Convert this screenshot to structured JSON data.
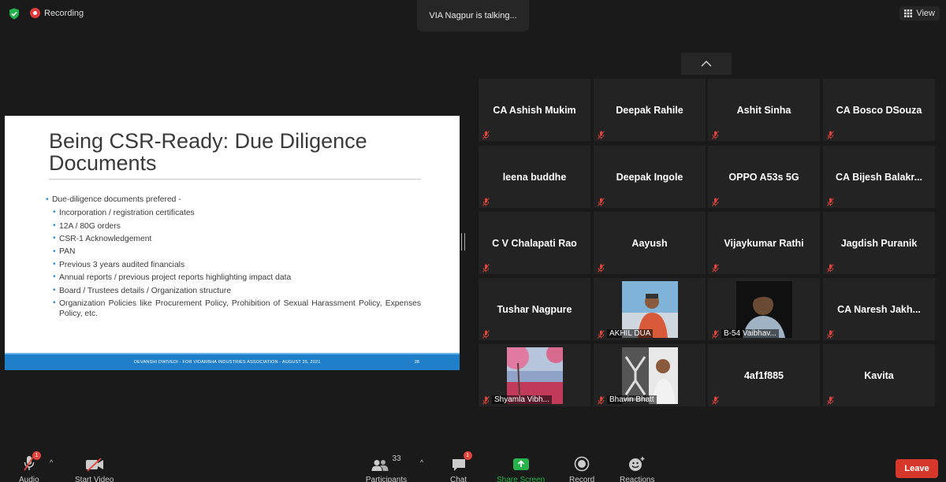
{
  "top": {
    "recording_label": "Recording",
    "talking_label": "VIA Nagpur is talking...",
    "view_label": "View"
  },
  "slide": {
    "title": "Being CSR-Ready: Due Diligence Documents",
    "intro": "Due-diligence documents prefered -",
    "bullets": [
      "Incorporation / registration certificates",
      "12A / 80G orders",
      "CSR-1 Acknowledgement",
      "PAN",
      "Previous 3 years audited financials",
      "Annual reports / previous project reports highlighting impact data",
      "Board / Trustees details / Organization structure",
      "Organization Policies like Procurement Policy, Prohibition of Sexual Harassment Policy, Expenses Policy, etc."
    ],
    "footer_text": "DEVANSHI DWIVEDI - FOR VIDARBHA INDUSTRIES ASSOCIATION - AUGUST 25, 2021",
    "page_number": "28"
  },
  "participants": [
    {
      "name": "CA Ashish Mukim"
    },
    {
      "name": "Deepak Rahile"
    },
    {
      "name": "Ashit Sinha"
    },
    {
      "name": "CA Bosco DSouza"
    },
    {
      "name": "leena buddhe"
    },
    {
      "name": "Deepak Ingole"
    },
    {
      "name": "OPPO A53s 5G"
    },
    {
      "name": "CA  Bijesh  Balakr..."
    },
    {
      "name": "C V Chalapati Rao"
    },
    {
      "name": "Aayush"
    },
    {
      "name": "Vijaykumar Rathi"
    },
    {
      "name": "Jagdish Puranik"
    },
    {
      "name": "Tushar Nagpure"
    },
    {
      "name": "AKHIL DUA"
    },
    {
      "name": "B-54 Vaibhav..."
    },
    {
      "name": "CA Naresh Jakh..."
    },
    {
      "name": "Shyamla Vibh..."
    },
    {
      "name": "Bhavin Bhatt"
    },
    {
      "name": "4af1f885"
    },
    {
      "name": "Kavita"
    }
  ],
  "toolbar": {
    "audio_label": "Audio",
    "audio_badge": "1",
    "video_label": "Start Video",
    "participants_label": "Participants",
    "participants_count": "33",
    "chat_label": "Chat",
    "chat_badge": "1",
    "share_label": "Share Screen",
    "record_label": "Record",
    "reactions_label": "Reactions",
    "leave_label": "Leave"
  },
  "colors": {
    "share_green": "#27b24a",
    "leave_red": "#d6372b",
    "mute_red": "#e0443b",
    "slide_footer_blue": "#1f7fc9"
  }
}
